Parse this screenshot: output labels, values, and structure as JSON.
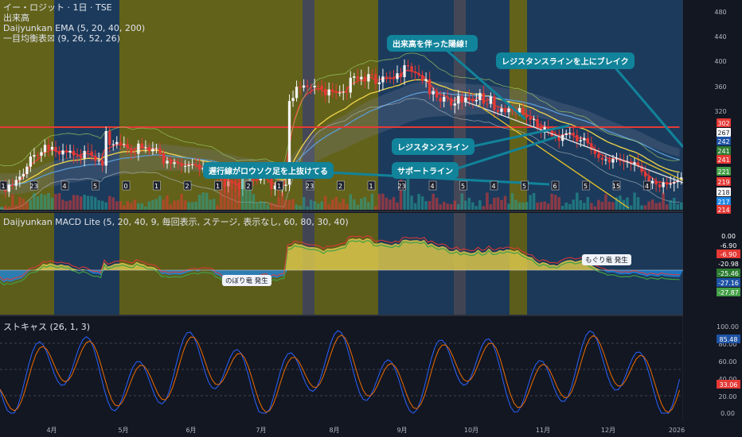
{
  "header": {
    "symbol_line": "イー・ロジット · 1日 · TSE",
    "volume_label": "出来高",
    "ema_label": "Daijyunkan EMA (5, 20, 40, 200)",
    "ichimoku_label": "一目均衡表☒ (9, 26, 52, 26)"
  },
  "macd_panel": {
    "label": "Daijyunkan MACD Lite (5, 20, 40, 9, 毎回表示, ステージ, 表示なし, 60, 80, 30, 40)",
    "note_up": "のぼり竜 発生",
    "note_down": "もぐり竜 発生",
    "axis": [
      "0.00",
      "-6.90",
      "-6.90",
      "-20.98",
      "-25.46",
      "-27.16",
      "-27.87"
    ],
    "axis_colors": [
      "#131722",
      "#131722",
      "#e53935",
      "#131722",
      "#2e7d32",
      "#1e53a5",
      "#43a047"
    ]
  },
  "stoch_panel": {
    "label": "ストキャス (26, 1, 3)",
    "axis": [
      "100.00",
      "80.00",
      "60.00",
      "40.00",
      "20.00",
      "0.00"
    ],
    "tags": [
      "85.48",
      "33.06"
    ]
  },
  "price_axis": {
    "ticks": [
      "480",
      "440",
      "400",
      "360",
      "320"
    ],
    "tags": [
      "302",
      "267",
      "242",
      "241",
      "241",
      "221",
      "219",
      "218",
      "217",
      "214"
    ],
    "tag_colors": [
      "#e53935",
      "#ffffff",
      "#1e53a5",
      "#2e7d32",
      "#e53935",
      "#43a047",
      "#e53935",
      "#ffffff",
      "#1e88e5",
      "#e53935"
    ]
  },
  "time_axis": [
    "4月",
    "5月",
    "6月",
    "7月",
    "8月",
    "9月",
    "10月",
    "11月",
    "12月",
    "2026"
  ],
  "annotations": {
    "bullish_volume": "出来高を伴った陽線！",
    "resistance_break": "レジスタンスラインを上にブレイク",
    "resistance": "レジスタンスライン",
    "support": "サポートライン",
    "lagging": "遅行線がロウソク足を上抜けてる"
  },
  "event_markers": [
    "1",
    "23",
    "4",
    "5",
    "0",
    "1",
    "2",
    "1",
    "2",
    "1",
    "23",
    "2",
    "1",
    "23",
    "4",
    "5",
    "4",
    "5",
    "6",
    "5",
    "15",
    "4"
  ],
  "colors": {
    "background": "#131722",
    "yellow_band": "#6b6a1a",
    "blue_band": "#1e3f63",
    "ema200": "#e53935",
    "resistance": "#e0e0e0",
    "support_line": "#e6c229",
    "annotation": "#11839a"
  }
}
